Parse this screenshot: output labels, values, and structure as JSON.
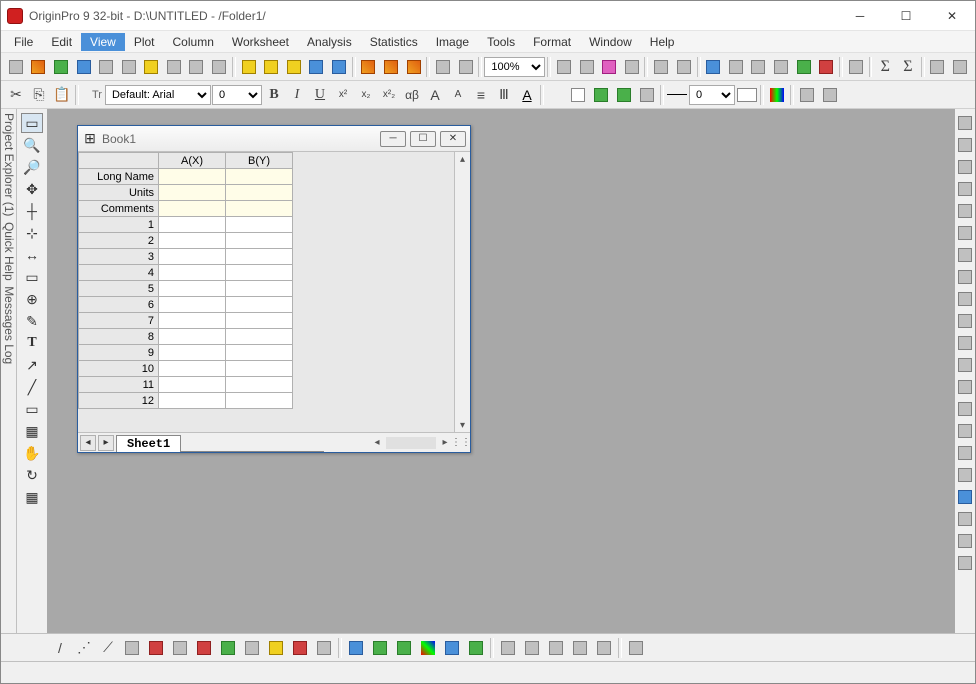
{
  "window": {
    "title": "OriginPro 9 32-bit - D:\\UNTITLED - /Folder1/"
  },
  "menu": {
    "items": [
      "File",
      "Edit",
      "View",
      "Plot",
      "Column",
      "Worksheet",
      "Analysis",
      "Statistics",
      "Image",
      "Tools",
      "Format",
      "Window",
      "Help"
    ],
    "active": "View"
  },
  "format": {
    "font": "Default: Arial",
    "size": "0",
    "zoom": "100%"
  },
  "side": {
    "left_tab1": "Project Explorer (1)",
    "left_tab2": "Quick Help",
    "left_tab3": "Messages Log"
  },
  "book": {
    "title": "Book1",
    "columns": [
      "A(X)",
      "B(Y)"
    ],
    "meta_rows": [
      "Long Name",
      "Units",
      "Comments"
    ],
    "data_rows": [
      "1",
      "2",
      "3",
      "4",
      "5",
      "6",
      "7",
      "8",
      "9",
      "10",
      "11",
      "12"
    ],
    "sheet_tab": "Sheet1"
  },
  "status": ""
}
